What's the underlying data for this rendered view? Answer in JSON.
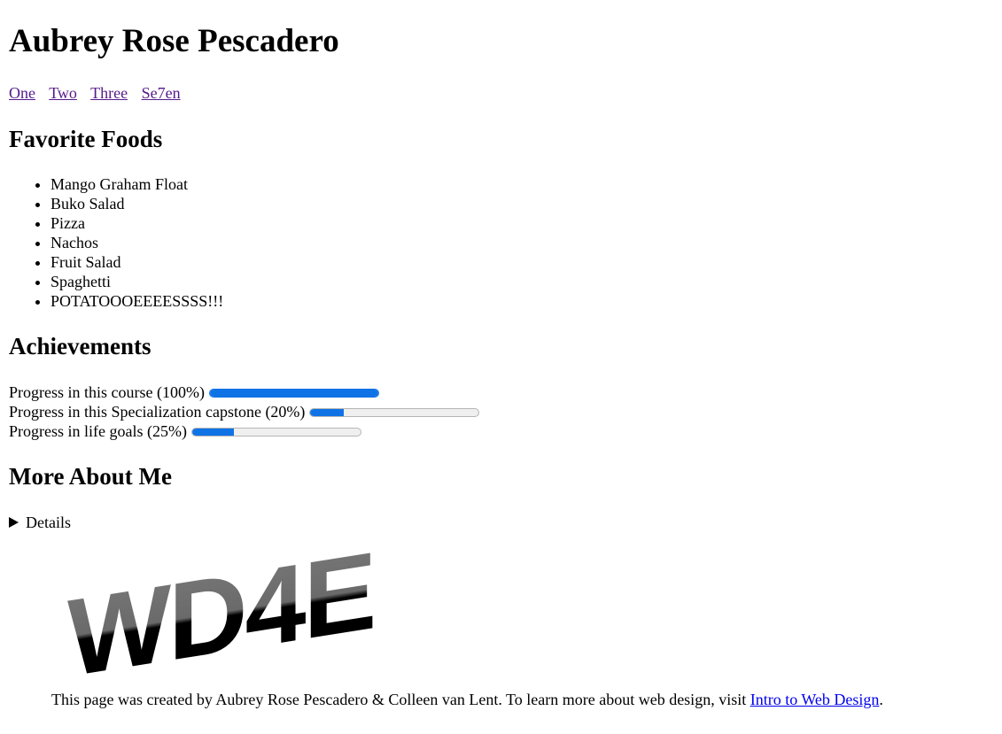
{
  "header": {
    "title": "Aubrey Rose Pescadero"
  },
  "nav": {
    "links": [
      "One",
      "Two",
      "Three",
      "Se7en"
    ]
  },
  "foods": {
    "heading": "Favorite Foods",
    "items": [
      "Mango Graham Float",
      "Buko Salad",
      "Pizza",
      "Nachos",
      "Fruit Salad",
      "Spaghetti",
      "POTATOOOEEEESSSS!!!"
    ]
  },
  "achievements": {
    "heading": "Achievements",
    "items": [
      {
        "label": "Progress in this course (100%)",
        "progress": 1.0
      },
      {
        "label": "Progress in this Specialization capstone (20%)",
        "progress": 0.2
      },
      {
        "label": "Progress in life goals (25%)",
        "progress": 0.25
      }
    ]
  },
  "more": {
    "heading": "More About Me",
    "summary": "Details"
  },
  "logo": {
    "text": "WD4E"
  },
  "footer": {
    "text": "This page was created by Aubrey Rose Pescadero & Colleen van Lent. To learn more about web design, visit ",
    "link_text": "Intro to Web Design",
    "end": "."
  },
  "colors": {
    "progress_fill": "#0f73e6",
    "visited_link": "#551a8b",
    "link": "#0000ee"
  }
}
